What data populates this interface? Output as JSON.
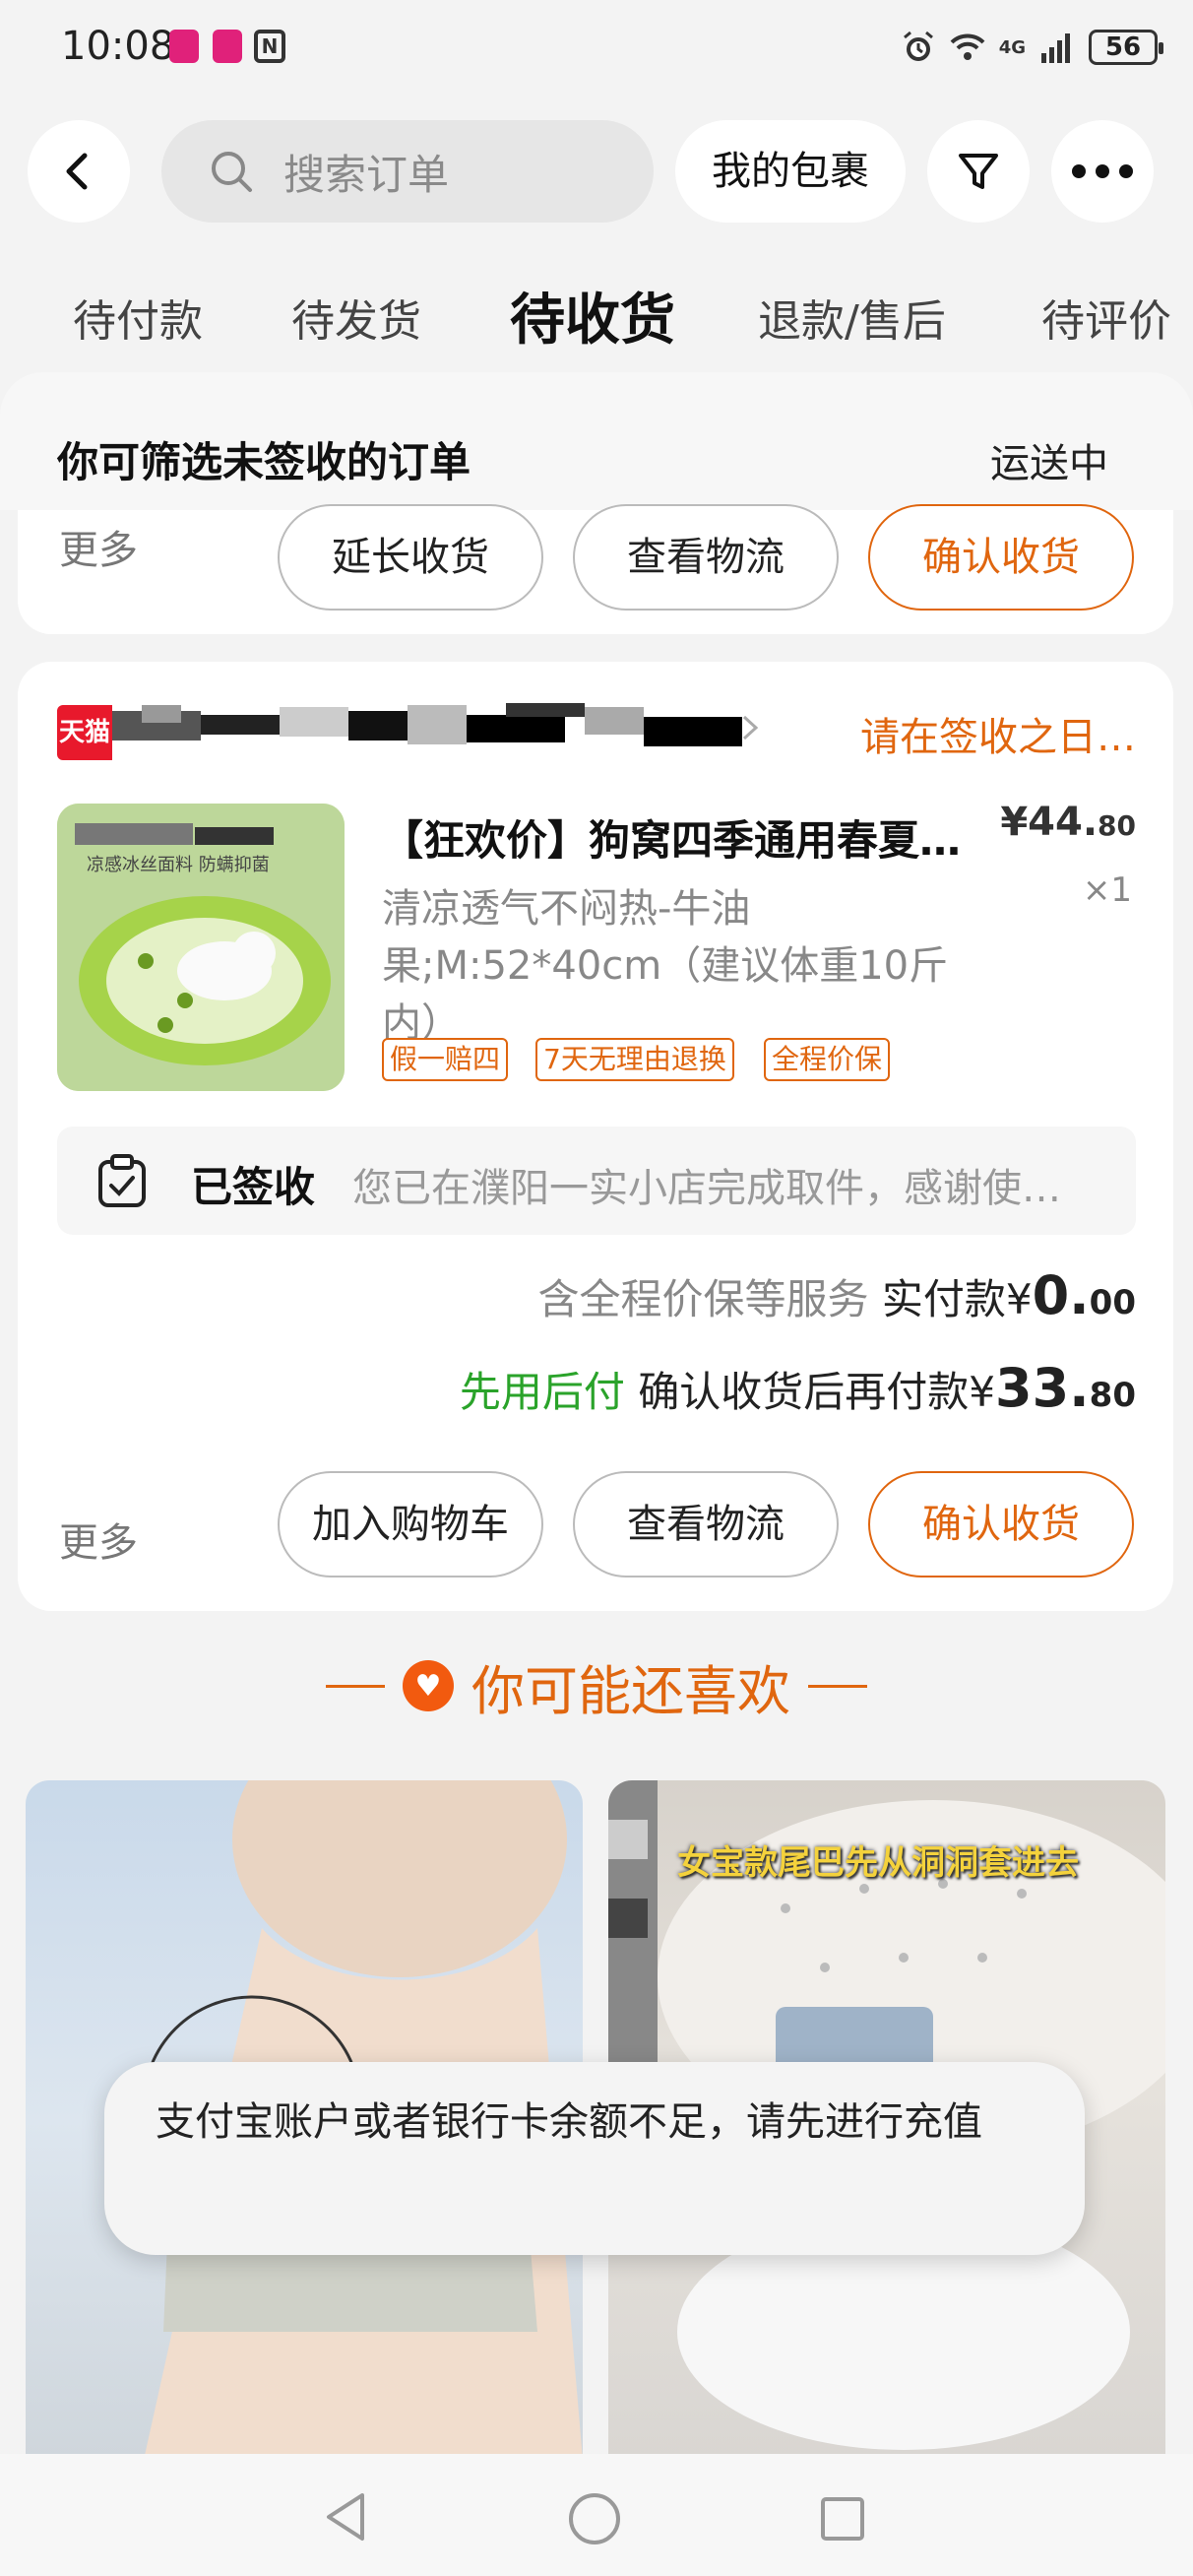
{
  "status_bar": {
    "time": "10:08",
    "app_badges": [
      "聚划算",
      "聚划算"
    ],
    "nfc": "N",
    "network": "4G",
    "battery": "56"
  },
  "header": {
    "search_placeholder": "搜索订单",
    "my_packages": "我的包裹"
  },
  "tabs": [
    {
      "label": "待付款"
    },
    {
      "label": "待发货"
    },
    {
      "label": "待收货"
    },
    {
      "label": "退款/售后"
    },
    {
      "label": "待评价"
    }
  ],
  "filter_bar": {
    "title": "你可筛选未签收的订单",
    "status": "运送中"
  },
  "order1": {
    "more": "更多",
    "buttons": [
      "延长收货",
      "查看物流",
      "确认收货"
    ]
  },
  "order2": {
    "store_badge": "天猫",
    "sign_tip": "请在签收之日…",
    "product_title": "【狂欢价】狗窝四季通用春夏…",
    "price_main": "¥44.",
    "price_cents": "80",
    "qty": "×1",
    "spec": "清凉透气不闷热-牛油果;M:52*40cm（建议体重10斤内）",
    "image_caption": "凉感冰丝面料  防螨抑菌",
    "tags": [
      "假一赔四",
      "7天无理由退换",
      "全程价保"
    ],
    "logistics_status": "已签收",
    "logistics_desc": "您已在濮阳一实小店完成取件，感谢使…",
    "service_note": "含全程价保等服务",
    "paid_label": "实付款",
    "paid_currency": "¥",
    "paid_main": "0.",
    "paid_cents": "00",
    "pay_later": "先用后付",
    "pay_later_label": "确认收货后再付款",
    "pay_later_currency": "¥",
    "pay_later_main": "33.",
    "pay_later_cents": "80",
    "more": "更多",
    "buttons": [
      "加入购物车",
      "查看物流",
      "确认收货"
    ]
  },
  "recommend": {
    "title": "你可能还喜欢",
    "item2_caption": "女宝款尾巴先从洞洞套进去"
  },
  "toast": "支付宝账户或者银行卡余额不足，请先进行充值",
  "colors": {
    "accent": "#e0660f",
    "green": "#2aa32a",
    "tmall_red": "#e8192c"
  }
}
